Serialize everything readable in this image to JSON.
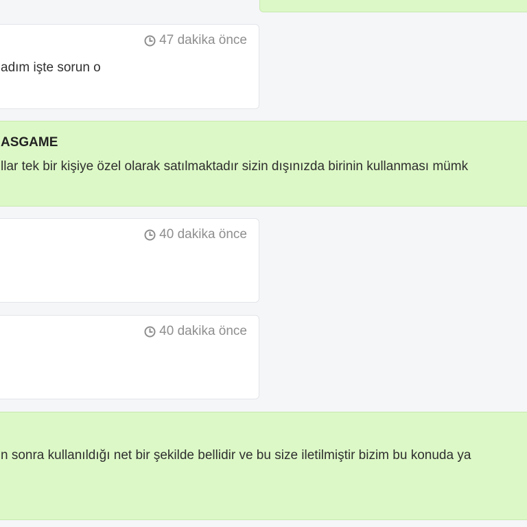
{
  "messages": [
    {
      "role": "agent",
      "text": ""
    },
    {
      "role": "user",
      "time": "47 dakika önce",
      "text": "adım işte sorun o"
    },
    {
      "role": "agent",
      "sender": "ASGAME",
      "text": "llar tek bir kişiye özel olarak satılmaktadır sizin dışınızda birinin kullanması mümk"
    },
    {
      "role": "user",
      "time": "40 dakika önce",
      "text": ""
    },
    {
      "role": "user",
      "time": "40 dakika önce",
      "text": ""
    },
    {
      "role": "agent",
      "text": "n sonra kullanıldığı net bir şekilde bellidir ve bu size iletilmiştir bizim bu konuda ya"
    }
  ],
  "icons": {
    "timestamp": "clock-icon"
  }
}
